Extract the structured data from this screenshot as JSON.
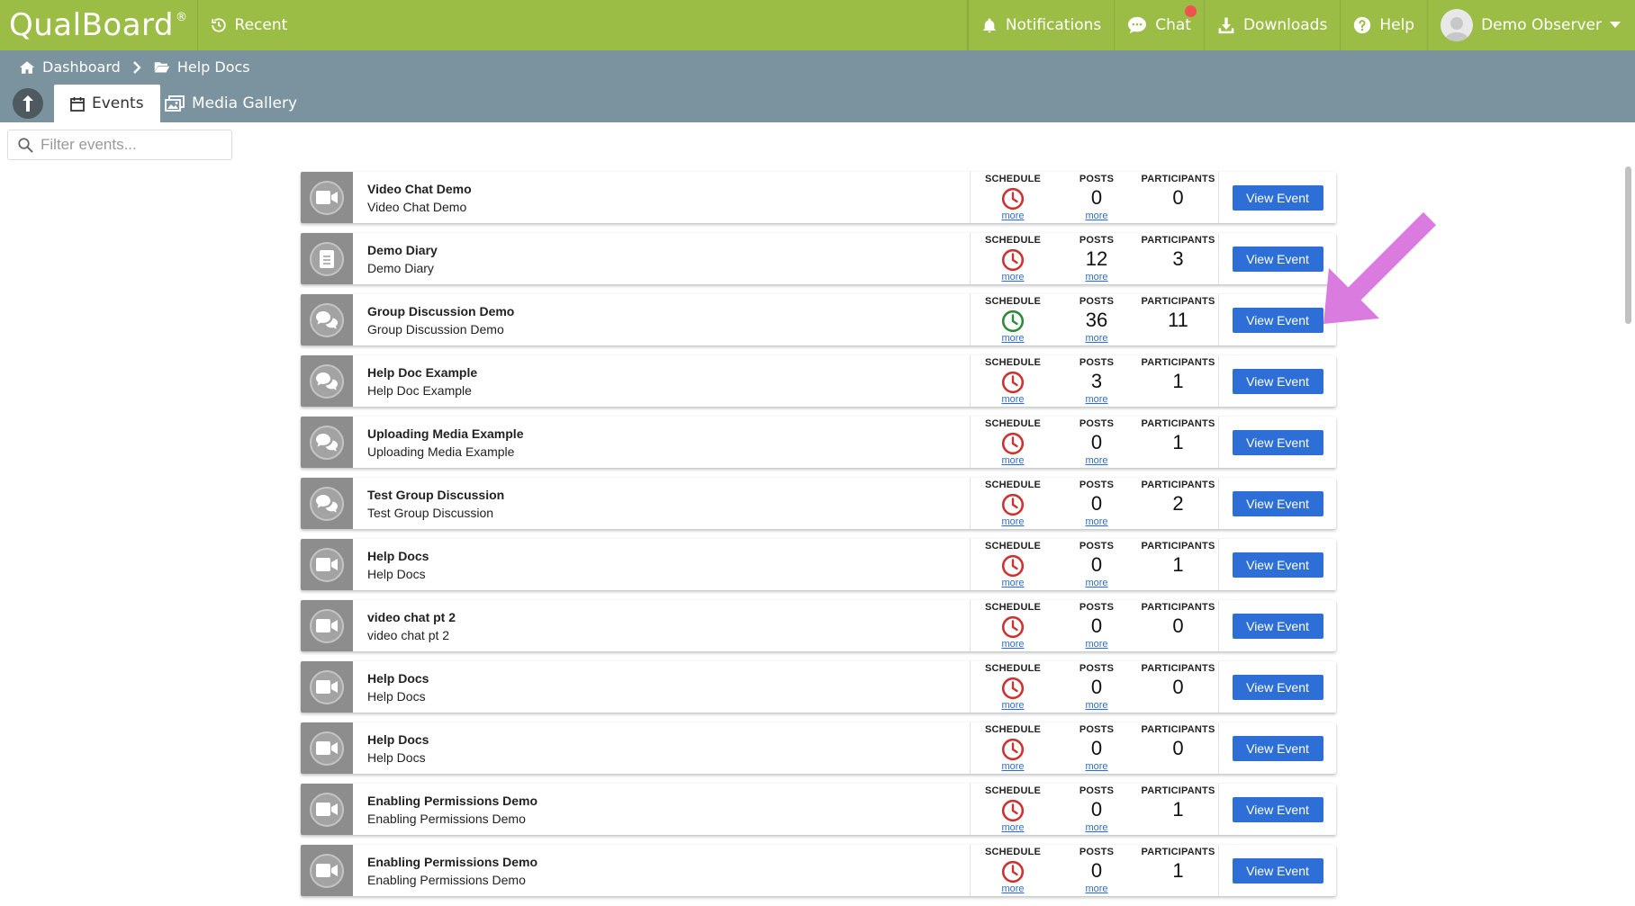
{
  "topbar": {
    "logo": "QualBoard",
    "logo_mark": "®",
    "recent_label": "Recent",
    "notifications_label": "Notifications",
    "chat_label": "Chat",
    "downloads_label": "Downloads",
    "help_label": "Help",
    "user_label": "Demo Observer"
  },
  "breadcrumb": {
    "items": [
      "Dashboard",
      "Help Docs"
    ]
  },
  "tabs": [
    {
      "label": "Events",
      "icon": "calendar-icon",
      "active": true
    },
    {
      "label": "Media Gallery",
      "icon": "media-gallery-icon",
      "active": false
    }
  ],
  "filter": {
    "placeholder": "Filter events...",
    "value": ""
  },
  "stat_headers": {
    "schedule": "SCHEDULE",
    "posts": "POSTS",
    "participants": "PARTICIPANTS",
    "more": "more"
  },
  "view_event_label": "View Event",
  "colors": {
    "topbar": "#9bbd45",
    "subbar": "#7b939e",
    "button": "#2d6fd6",
    "schedule_inactive": "#cc3333",
    "schedule_active": "#2e8b3a",
    "annotation_arrow": "#da7be0"
  },
  "events": [
    {
      "title": "Video Chat Demo",
      "subtitle": "Video Chat Demo",
      "type": "video-chat-icon",
      "schedule_status": "inactive",
      "posts": "0",
      "participants": "0"
    },
    {
      "title": "Demo Diary",
      "subtitle": "Demo Diary",
      "type": "diary-icon",
      "schedule_status": "inactive",
      "posts": "12",
      "participants": "3"
    },
    {
      "title": "Group Discussion Demo",
      "subtitle": "Group Discussion Demo",
      "type": "discussion-icon",
      "schedule_status": "active",
      "posts": "36",
      "participants": "11"
    },
    {
      "title": "Help Doc Example",
      "subtitle": "Help Doc Example",
      "type": "discussion-icon",
      "schedule_status": "inactive",
      "posts": "3",
      "participants": "1"
    },
    {
      "title": "Uploading Media Example",
      "subtitle": "Uploading Media Example",
      "type": "discussion-icon",
      "schedule_status": "inactive",
      "posts": "0",
      "participants": "1"
    },
    {
      "title": "Test Group Discussion",
      "subtitle": "Test Group Discussion",
      "type": "discussion-icon",
      "schedule_status": "inactive",
      "posts": "0",
      "participants": "2"
    },
    {
      "title": "Help Docs",
      "subtitle": "Help Docs",
      "type": "video-chat-icon",
      "schedule_status": "inactive",
      "posts": "0",
      "participants": "1"
    },
    {
      "title": "video chat pt 2",
      "subtitle": "video chat pt 2",
      "type": "video-chat-icon",
      "schedule_status": "inactive",
      "posts": "0",
      "participants": "0"
    },
    {
      "title": "Help Docs",
      "subtitle": "Help Docs",
      "type": "video-chat-icon",
      "schedule_status": "inactive",
      "posts": "0",
      "participants": "0"
    },
    {
      "title": "Help Docs",
      "subtitle": "Help Docs",
      "type": "video-chat-icon",
      "schedule_status": "inactive",
      "posts": "0",
      "participants": "0"
    },
    {
      "title": "Enabling Permissions Demo",
      "subtitle": "Enabling Permissions Demo",
      "type": "video-chat-icon",
      "schedule_status": "inactive",
      "posts": "0",
      "participants": "1"
    },
    {
      "title": "Enabling Permissions Demo",
      "subtitle": "Enabling Permissions Demo",
      "type": "video-chat-icon",
      "schedule_status": "inactive",
      "posts": "0",
      "participants": "1"
    }
  ]
}
